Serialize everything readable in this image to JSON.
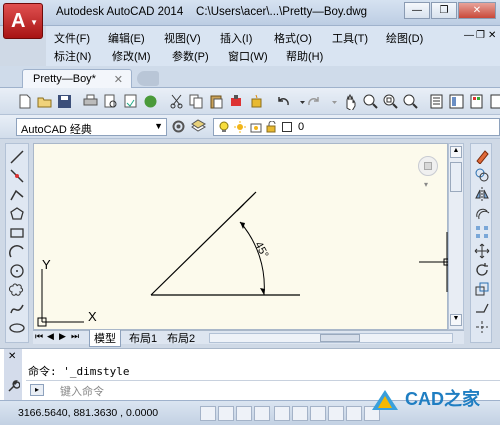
{
  "app": {
    "logo_letter": "A",
    "title": "Autodesk AutoCAD 2014",
    "filepath": "C:\\Users\\acer\\...\\Pretty—Boy.dwg"
  },
  "window_controls": {
    "minimize": "—",
    "restore": "❐",
    "close": "✕"
  },
  "menu": {
    "row1": [
      "文件(F)",
      "编辑(E)",
      "视图(V)",
      "插入(I)",
      "格式(O)",
      "工具(T)",
      "绘图(D)"
    ],
    "row2": [
      "标注(N)",
      "修改(M)",
      "参数(P)",
      "窗口(W)",
      "帮助(H)"
    ],
    "mdi_controls": [
      "—",
      "❐",
      "✕"
    ]
  },
  "document_tab": {
    "label": "Pretty—Boy*",
    "close": "✕"
  },
  "workspace": {
    "selected": "AutoCAD 经典"
  },
  "layer": {
    "current": "0"
  },
  "drawing": {
    "angle_label": "45°",
    "ucs_x": "X",
    "ucs_y": "Y"
  },
  "layout_tabs": [
    "模型",
    "布局1",
    "布局2"
  ],
  "layout_nav": [
    "⏮",
    "◀",
    "▶",
    "⏭"
  ],
  "command": {
    "history": "命令: '_dimstyle",
    "prompt_placeholder": "键入命令"
  },
  "status": {
    "coordinates": "3166.5640, 881.3630 , 0.0000"
  },
  "watermark": {
    "text": "CAD之家"
  },
  "colors": {
    "canvas_bg": "#fcfaec",
    "app_red": "#c41e1e",
    "chrome_blue": "#d9e4f2"
  }
}
